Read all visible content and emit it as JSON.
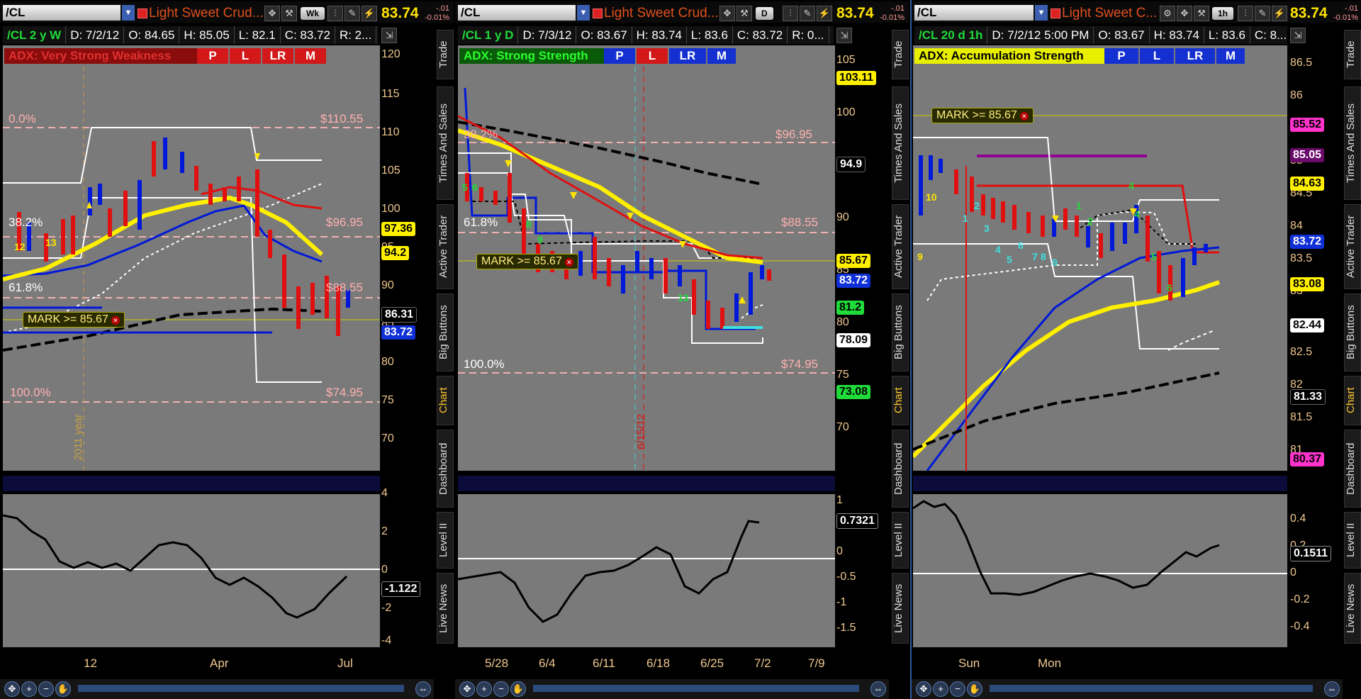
{
  "panes": [
    {
      "symbol": "/CL",
      "description": "Light Sweet Crud...",
      "timeframe_button": "Wk",
      "last_price": "83.74",
      "change": "-.01",
      "change_pct": "-0.01%",
      "info": {
        "symbol": "/CL 2 y W",
        "date": "D: 7/2/12",
        "open": "O: 84.65",
        "high": "H: 85.05",
        "low": "L: 82.1",
        "close": "C: 83.72",
        "range": "R: 2..."
      },
      "adx": {
        "label": "ADX:  Very Strong Weakness",
        "bg": "#8b0c0c",
        "color": "#e03030",
        "buttons": [
          "P",
          "L",
          "LR",
          "M"
        ],
        "btn_bg": "#d21818"
      },
      "y_labels": [
        "120",
        "115",
        "110",
        "105",
        "100",
        "95",
        "90",
        "85",
        "80",
        "75",
        "70"
      ],
      "y_tags": [
        {
          "text": "97.36",
          "bg": "#fff000",
          "color": "#000"
        },
        {
          "text": "94.2",
          "bg": "#fff000",
          "color": "#000"
        },
        {
          "text": "86.31",
          "bg": "#000",
          "color": "#fff"
        },
        {
          "text": "83.72",
          "bg": "#1030d8",
          "color": "#fff"
        }
      ],
      "fib_labels": [
        "0.0%",
        "$110.55",
        "38.2%",
        "$96.95",
        "61.8%",
        "$88.55",
        "100.0%",
        "$74.95"
      ],
      "marker": "MARK >= 85.67",
      "vertical_label": "2011 year",
      "counts": [
        "12",
        "13"
      ],
      "sub_y_labels": [
        "4",
        "2",
        "0",
        "-2",
        "-4"
      ],
      "sub_tag": "-1.122",
      "x_labels": [
        "12",
        "Apr",
        "Jul"
      ]
    },
    {
      "symbol": "/CL",
      "description": "Light Sweet Crud...",
      "timeframe_button": "D",
      "last_price": "83.74",
      "change": "-.01",
      "change_pct": "-0.01%",
      "info": {
        "symbol": "/CL 1 y D",
        "date": "D: 7/3/12",
        "open": "O: 83.67",
        "high": "H: 83.74",
        "low": "L: 83.6",
        "close": "C: 83.72",
        "range": "R: 0..."
      },
      "adx": {
        "label": "ADX:  Strong Strength",
        "bg": "#0a5a0a",
        "color": "#2aff2a",
        "buttons": [
          "P",
          "L",
          "LR",
          "M"
        ],
        "btn_bg": "#1430d0"
      },
      "y_labels": [
        "105",
        "100",
        "95",
        "90",
        "85",
        "80",
        "75",
        "70"
      ],
      "y_tags": [
        {
          "text": "103.11",
          "bg": "#fff000",
          "color": "#000"
        },
        {
          "text": "94.9",
          "bg": "#000",
          "color": "#fff"
        },
        {
          "text": "85.67",
          "bg": "#fff000",
          "color": "#000"
        },
        {
          "text": "83.72",
          "bg": "#1030d8",
          "color": "#fff"
        },
        {
          "text": "81.2",
          "bg": "#1fdc3a",
          "color": "#000"
        },
        {
          "text": "78.09",
          "bg": "#fff",
          "color": "#000"
        },
        {
          "text": "73.08",
          "bg": "#1fdc3a",
          "color": "#000"
        }
      ],
      "fib_labels": [
        "38.2%",
        "$96.95",
        "61.8%",
        "$88.55",
        "100.0%",
        "$74.95"
      ],
      "marker": "MARK >= 85.67",
      "vertical_label": "6/15/12",
      "counts": [
        "5",
        "6",
        "8",
        "9",
        "13"
      ],
      "sub_y_labels": [
        "1",
        "0.5",
        "0",
        "-0.5",
        "-1",
        "-1.5"
      ],
      "sub_tag": "0.7321",
      "x_labels": [
        "5/28",
        "6/4",
        "6/11",
        "6/18",
        "6/25",
        "7/2",
        "7/9"
      ]
    },
    {
      "symbol": "/CL",
      "description": "Light Sweet C...",
      "timeframe_button": "1h",
      "last_price": "83.74",
      "change": "-.01",
      "change_pct": "-0.01%",
      "info": {
        "symbol": "/CL 20 d 1h",
        "date": "D: 7/2/12 5:00 PM",
        "open": "O: 83.67",
        "high": "H: 83.74",
        "low": "L: 83.6",
        "close": "C: 8..."
      },
      "adx": {
        "label": "ADX:  Accumulation Strength",
        "bg": "#e8f000",
        "color": "#000",
        "buttons": [
          "P",
          "L",
          "LR",
          "M"
        ],
        "btn_bg": "#1430d0"
      },
      "y_labels": [
        "86.5",
        "86",
        "85.5",
        "85",
        "84.5",
        "84",
        "83.5",
        "83",
        "82.5",
        "82",
        "81.5",
        "81"
      ],
      "y_tags": [
        {
          "text": "85.52",
          "bg": "#ff33cc",
          "color": "#000"
        },
        {
          "text": "85.05",
          "bg": "#6a0a6a",
          "color": "#fff"
        },
        {
          "text": "84.63",
          "bg": "#fff000",
          "color": "#000"
        },
        {
          "text": "83.72",
          "bg": "#1030d8",
          "color": "#fff"
        },
        {
          "text": "83.08",
          "bg": "#fff000",
          "color": "#000"
        },
        {
          "text": "82.44",
          "bg": "#fff",
          "color": "#000"
        },
        {
          "text": "81.33",
          "bg": "#000",
          "color": "#fff"
        },
        {
          "text": "80.37",
          "bg": "#ff33cc",
          "color": "#000"
        }
      ],
      "fib_labels": [],
      "marker": "MARK >= 85.67",
      "vertical_label": "",
      "counts": [
        "10",
        "9",
        "1",
        "2",
        "3",
        "4",
        "5",
        "6",
        "7",
        "8",
        "9",
        "1",
        "2",
        "4",
        "4",
        "5",
        "6"
      ],
      "sub_y_labels": [
        "0.4",
        "0.2",
        "0",
        "-0.2",
        "-0.4"
      ],
      "sub_tag": "0.1511",
      "x_labels": [
        "Sun",
        "Mon"
      ]
    }
  ],
  "side_tabs": [
    "Trade",
    "Times And Sales",
    "Active Trader",
    "Big Buttons",
    "Chart",
    "Dashboard",
    "Level II",
    "Live News"
  ],
  "active_side_tab": "Chart"
}
